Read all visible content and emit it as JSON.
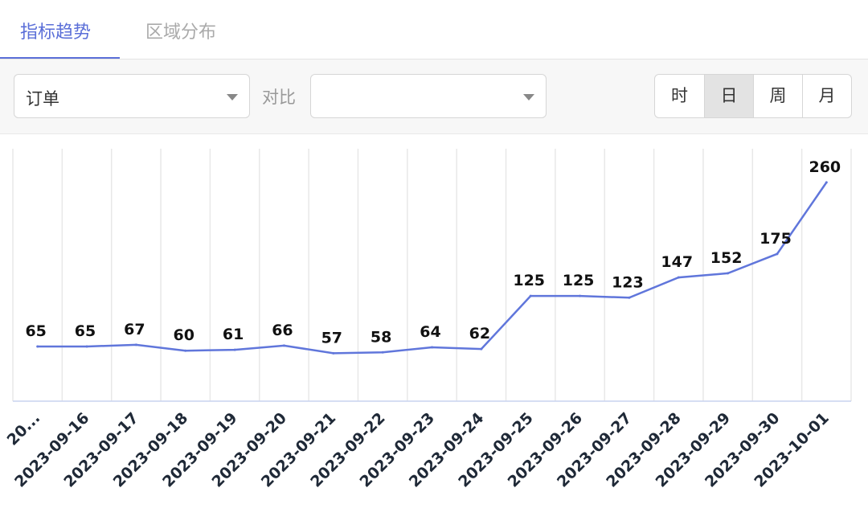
{
  "tabs": [
    {
      "label": "指标趋势",
      "active": true
    },
    {
      "label": "区域分布",
      "active": false
    }
  ],
  "toolbar": {
    "metric_value": "订单",
    "compare_label": "对比",
    "compare_value": "",
    "granularity": [
      {
        "label": "时",
        "active": false
      },
      {
        "label": "日",
        "active": true
      },
      {
        "label": "周",
        "active": false
      },
      {
        "label": "月",
        "active": false
      }
    ]
  },
  "colors": {
    "accent": "#5b6fd8",
    "line": "#6076db",
    "axis_text": "#1f2937"
  },
  "chart_data": {
    "type": "line",
    "categories": [
      "20...",
      "2023-09-16",
      "2023-09-17",
      "2023-09-18",
      "2023-09-19",
      "2023-09-20",
      "2023-09-21",
      "2023-09-22",
      "2023-09-23",
      "2023-09-24",
      "2023-09-25",
      "2023-09-26",
      "2023-09-27",
      "2023-09-28",
      "2023-09-29",
      "2023-09-30",
      "2023-10-01"
    ],
    "values": [
      65,
      65,
      67,
      60,
      61,
      66,
      57,
      58,
      64,
      62,
      125,
      125,
      123,
      147,
      152,
      175,
      260
    ],
    "ylim": [
      0,
      300
    ],
    "grid": "vertical",
    "data_labels": true
  }
}
